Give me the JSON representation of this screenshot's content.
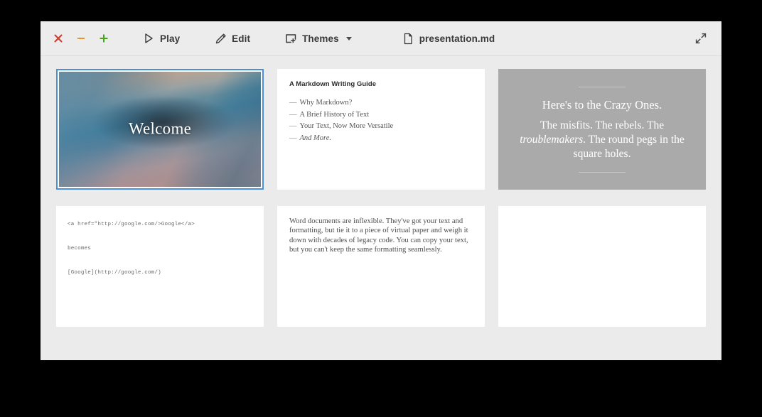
{
  "window": {
    "title": "presentation.md",
    "controls": [
      {
        "name": "close",
        "glyph": "x",
        "color": "#d0392b"
      },
      {
        "name": "minimize",
        "glyph": "minus",
        "color": "#e8962c"
      },
      {
        "name": "new",
        "glyph": "plus",
        "color": "#47a617"
      }
    ]
  },
  "toolbar": {
    "play_label": "Play",
    "edit_label": "Edit",
    "themes_label": "Themes",
    "file_label": "presentation.md",
    "play_icon": "play-triangle-icon",
    "edit_icon": "pencil-icon",
    "themes_icon": "add-theme-icon",
    "file_icon": "document-icon",
    "expand_icon": "expand-fullscreen-icon"
  },
  "accent": {
    "selection_border": "#4a90d9",
    "toolbar_bg": "#ececec",
    "canvas_bg": "#ebebeb",
    "slide_bg": "#ffffff",
    "quote_bg": "#aaaaaa"
  },
  "slides": [
    {
      "index": 1,
      "type": "photo-title",
      "selected": true,
      "title": "Welcome"
    },
    {
      "index": 2,
      "type": "heading-list",
      "selected": false,
      "heading": "A Markdown Writing Guide",
      "items": [
        {
          "dash": "—",
          "text": "Why Markdown?",
          "italic": false
        },
        {
          "dash": "—",
          "text": "A Brief History of Text",
          "italic": false
        },
        {
          "dash": "—",
          "text": "Your Text, Now More Versatile",
          "italic": false
        },
        {
          "dash": "—",
          "text": "And More.",
          "italic": true
        }
      ]
    },
    {
      "index": 3,
      "type": "quote",
      "selected": false,
      "line1": "Here's to the Crazy Ones.",
      "line2_pre": "The misfits. The rebels. The ",
      "line2_em": "troublemakers",
      "line2_post": ". The round pegs in the square holes."
    },
    {
      "index": 4,
      "type": "code",
      "selected": false,
      "code": "<a href=\"http://google.com/>Google</a>\n\nbecomes\n\n[Google](http://google.com/)"
    },
    {
      "index": 5,
      "type": "body",
      "selected": false,
      "text": "Word documents are inflexible. They've got your text and formatting, but tie it to a piece of virtual paper and weigh it down with decades of legacy code. You can copy your text, but you can't keep the same formatting seamlessly."
    },
    {
      "index": 6,
      "type": "blank",
      "selected": false
    }
  ]
}
